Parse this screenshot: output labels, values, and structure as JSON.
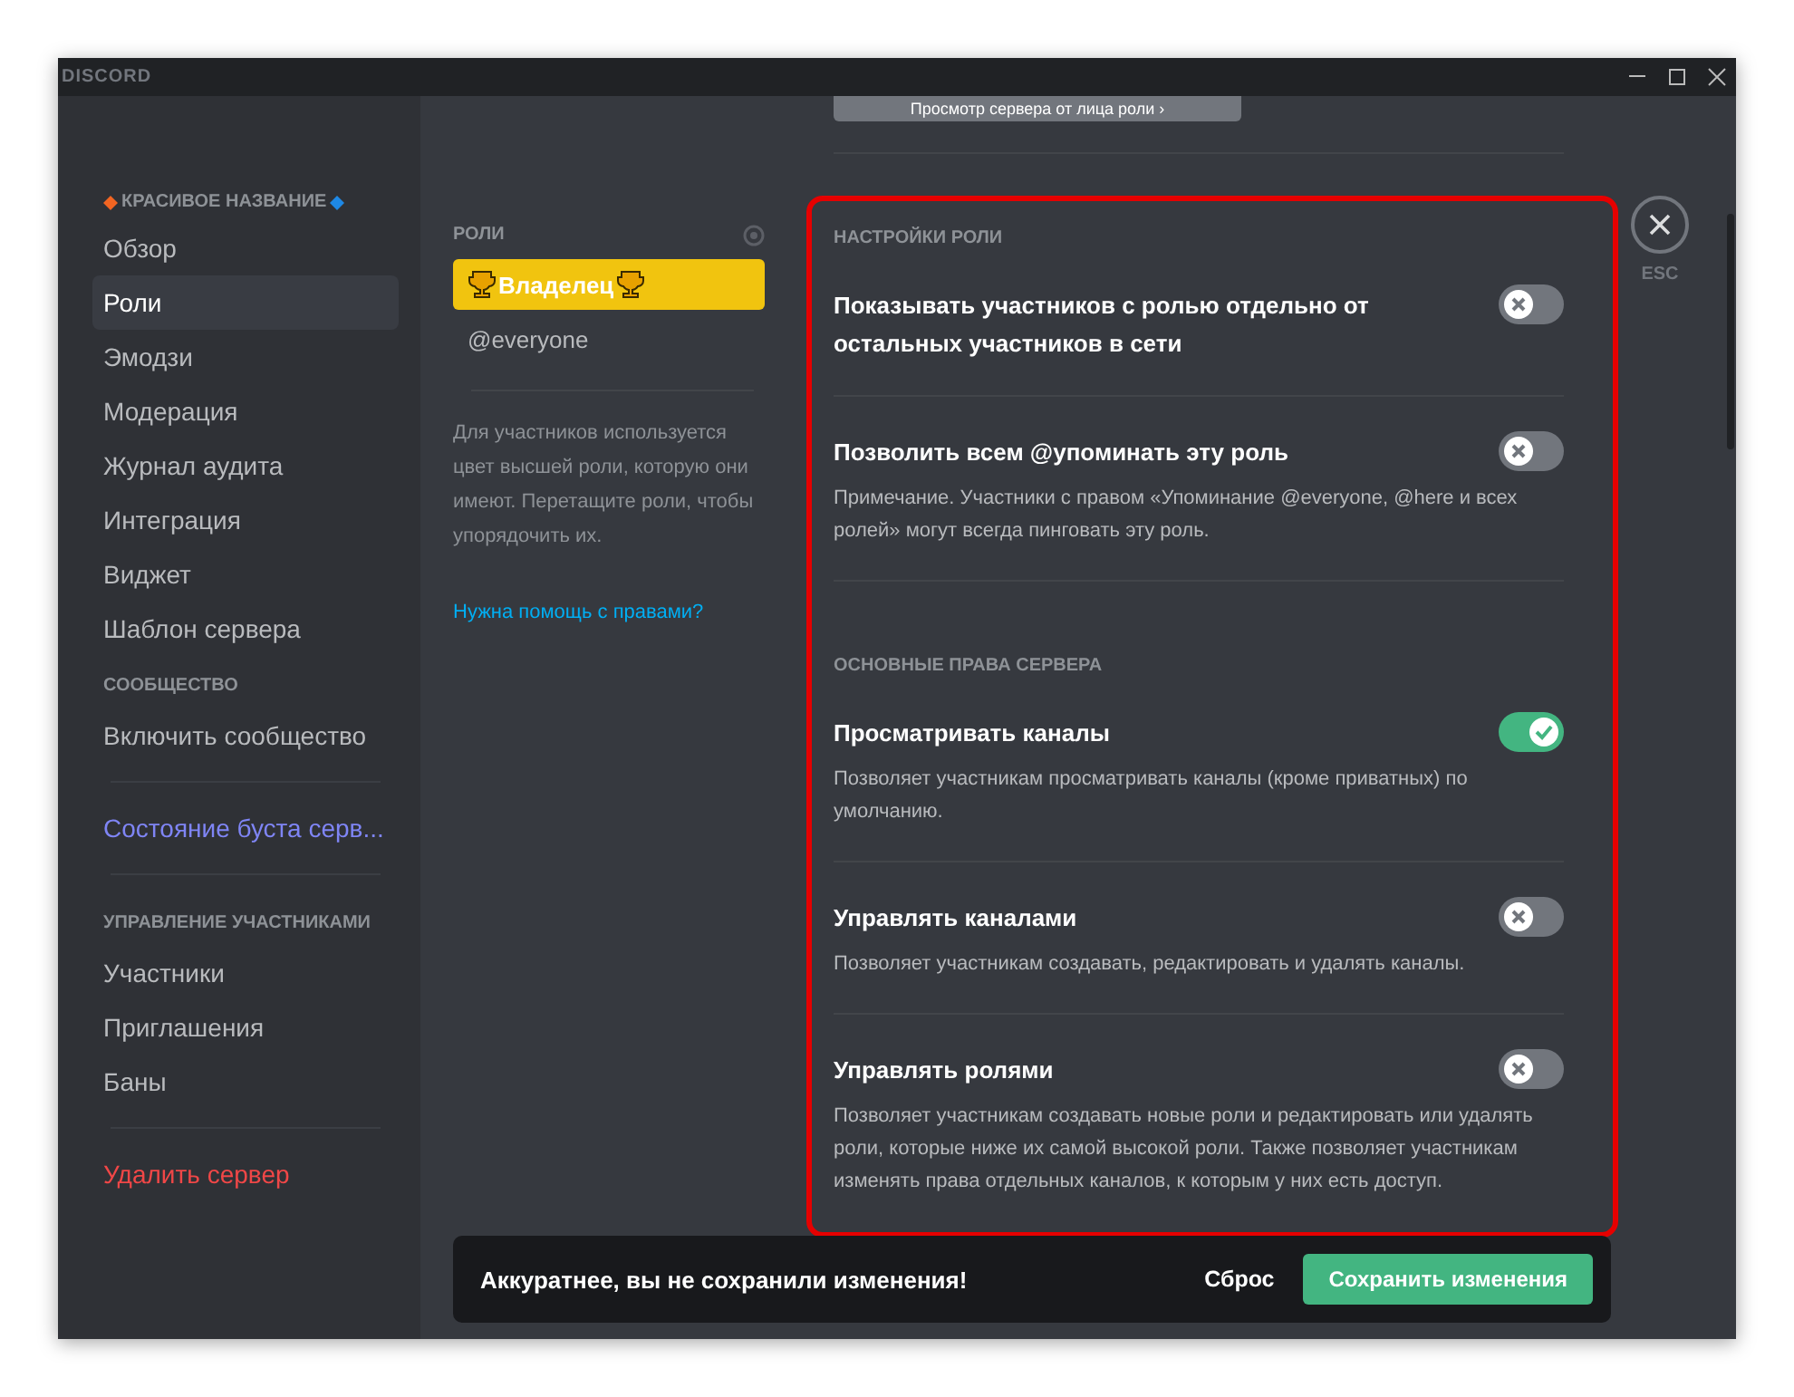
{
  "window": {
    "title": "DISCORD"
  },
  "sidebar": {
    "server_name": "КРАСИВОЕ НАЗВАНИЕ",
    "groups": [
      {
        "items": [
          {
            "label": "Обзор",
            "selected": false,
            "kind": "normal"
          },
          {
            "label": "Роли",
            "selected": true,
            "kind": "normal"
          },
          {
            "label": "Эмодзи",
            "selected": false,
            "kind": "normal"
          },
          {
            "label": "Модерация",
            "selected": false,
            "kind": "normal"
          },
          {
            "label": "Журнал аудита",
            "selected": false,
            "kind": "normal"
          },
          {
            "label": "Интеграция",
            "selected": false,
            "kind": "normal"
          },
          {
            "label": "Виджет",
            "selected": false,
            "kind": "normal"
          },
          {
            "label": "Шаблон сервера",
            "selected": false,
            "kind": "normal"
          }
        ]
      },
      {
        "heading": "СООБЩЕСТВО",
        "items": [
          {
            "label": "Включить сообщество",
            "selected": false,
            "kind": "normal"
          }
        ]
      },
      {
        "divider": true,
        "items": [
          {
            "label": "Состояние буста серв...",
            "selected": false,
            "kind": "boost"
          }
        ]
      },
      {
        "divider": true,
        "heading": "УПРАВЛЕНИЕ УЧАСТНИКАМИ",
        "items": [
          {
            "label": "Участники",
            "selected": false,
            "kind": "normal"
          },
          {
            "label": "Приглашения",
            "selected": false,
            "kind": "normal"
          },
          {
            "label": "Баны",
            "selected": false,
            "kind": "normal"
          }
        ]
      },
      {
        "divider": true,
        "items": [
          {
            "label": "Удалить сервер",
            "selected": false,
            "kind": "danger"
          }
        ]
      }
    ]
  },
  "roles": {
    "heading": "РОЛИ",
    "items": [
      {
        "label": "Владелец",
        "selected": true,
        "trophies": true
      },
      {
        "label": "@everyone",
        "selected": false,
        "trophies": false
      }
    ],
    "hint": "Для участников используется цвет высшей роли, которую они имеют. Перетащите роли, чтобы упорядочить их.",
    "help_link": "Нужна помощь с правами?"
  },
  "view_as_button": "Просмотр сервера от лица роли ›",
  "sections": [
    {
      "heading": "НАСТРОЙКИ РОЛИ",
      "settings": [
        {
          "title": "Показывать участников с ролью отдельно от остальных участников в сети",
          "checked": false
        },
        {
          "title": "Позволить всем @упоминать эту роль",
          "description": "Примечание. Участники с правом «Упоминание @everyone, @here и всех ролей» могут всегда пинговать эту роль.",
          "checked": false
        }
      ]
    },
    {
      "heading": "ОСНОВНЫЕ ПРАВА СЕРВЕРА",
      "settings": [
        {
          "title": "Просматривать каналы",
          "description": "Позволяет участникам просматривать каналы (кроме приватных) по умолчанию.",
          "checked": true
        },
        {
          "title": "Управлять каналами",
          "description": "Позволяет участникам создавать, редактировать и удалять каналы.",
          "checked": false
        },
        {
          "title": "Управлять ролями",
          "description": "Позволяет участникам создавать новые роли и редактировать или удалять роли, которые ниже их самой высокой роли. Также позволяет участникам изменять права отдельных каналов, к которым у них есть доступ.",
          "checked": false
        }
      ]
    }
  ],
  "close": {
    "label": "ESC"
  },
  "unsaved_bar": {
    "message": "Аккуратнее, вы не сохранили изменения!",
    "reset": "Сброс",
    "save": "Сохранить изменения"
  }
}
